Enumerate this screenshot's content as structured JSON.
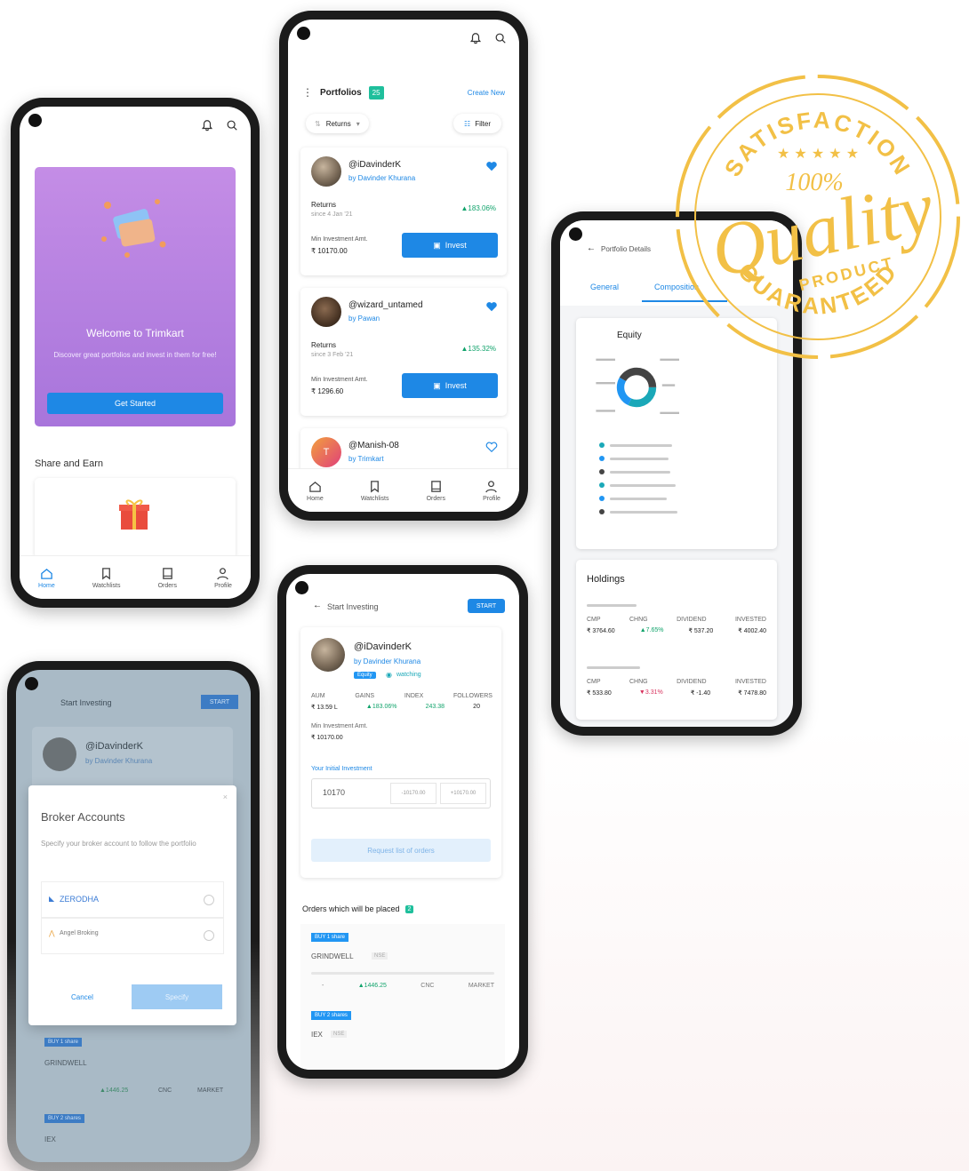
{
  "home": {
    "welcome_title": "Welcome to Trimkart",
    "welcome_desc": "Discover great portfolios and invest in them for free!",
    "get_started": "Get Started",
    "share_earn": "Share and Earn"
  },
  "nav": {
    "home": "Home",
    "watchlists": "Watchlists",
    "orders": "Orders",
    "profile": "Profile"
  },
  "portfolios": {
    "title": "Portfolios",
    "count": "25",
    "create_new": "Create New",
    "filter_returns": "Returns",
    "filter": "Filter",
    "returns_label": "Returns",
    "min_inv_label": "Min Investment Amt.",
    "invest": "Invest",
    "cards": [
      {
        "handle": "@iDavinderK",
        "by": "by Davinder Khurana",
        "since": "since 4 Jan '21",
        "returns": "▲183.06%",
        "min": "₹ 10170.00"
      },
      {
        "handle": "@wizard_untamed",
        "by": "by Pawan",
        "since": "since 3 Feb '21",
        "returns": "▲135.32%",
        "min": "₹ 1296.60"
      },
      {
        "handle": "@Manish-08",
        "by": "by Trimkart",
        "avatar_letter": "T"
      }
    ]
  },
  "details": {
    "title": "Portfolio Details",
    "tab_general": "General",
    "tab_composition": "Composition",
    "equity": "Equity",
    "holdings": "Holdings",
    "legend_colors": [
      "#1aa8b8",
      "#2196f3",
      "#444444",
      "#1aa8b8",
      "#2196f3",
      "#444444"
    ],
    "h1": {
      "cmp": "CMP",
      "chng": "CHNG",
      "dividend": "DIVIDEND",
      "invested": "INVESTED",
      "v_cmp": "₹ 3764.60",
      "v_chng": "▲7.65%",
      "v_div": "₹ 537.20",
      "v_inv": "₹ 4002.40"
    },
    "h2": {
      "cmp": "CMP",
      "chng": "CHNG",
      "dividend": "DIVIDEND",
      "invested": "INVESTED",
      "v_cmp": "₹ 533.80",
      "v_chng": "▼3.31%",
      "v_div": "₹ -1.40",
      "v_inv": "₹ 7478.80"
    }
  },
  "start": {
    "title": "Start Investing",
    "start_btn": "START",
    "handle": "@iDavinderK",
    "by": "by Davinder Khurana",
    "tag": "Equity",
    "watching": "watching",
    "aum": "AUM",
    "gains": "GAINS",
    "index": "INDEX",
    "followers": "FOLLOWERS",
    "v_aum": "₹ 13.59 L",
    "v_gains": "▲183.06%",
    "v_index": "243.38",
    "v_followers": "20",
    "min_label": "Min Investment Amt.",
    "min_value": "₹ 10170.00",
    "initial_label": "Your Initial Investment",
    "initial_value": "10170",
    "dec": "-10170.00",
    "inc": "+10170.00",
    "request": "Request list of orders",
    "orders_placed": "Orders which will be placed",
    "orders_count": "2",
    "buy1": "BUY 1 share",
    "stock1": "GRINDWELL",
    "nse": "NSE",
    "buy2": "BUY 2 shares",
    "stock2": "IEX",
    "cnc": "CNC",
    "market": "MARKET",
    "price1": "▲1446.25"
  },
  "broker": {
    "title": "Broker Accounts",
    "desc": "Specify your broker account to follow the portfolio",
    "zerodha": "ZERODHA",
    "angel": "Angel Broking",
    "cancel": "Cancel",
    "specify": "Specify"
  },
  "badge": {
    "top": "SATISFACTION",
    "percent": "100%",
    "quality": "Quality",
    "product": "PRODUCT",
    "bottom": "GUARANTEED",
    "stars": "★ ★ ★ ★ ★",
    "color": "#f2c046"
  }
}
